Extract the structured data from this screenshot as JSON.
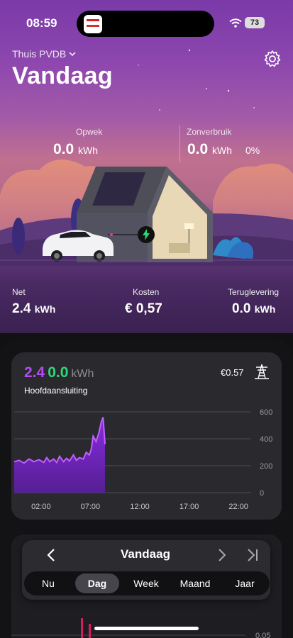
{
  "status": {
    "time": "08:59",
    "battery": "73"
  },
  "header": {
    "location": "Thuis PVDB",
    "title": "Vandaag"
  },
  "top_metrics": {
    "opwek": {
      "label": "Opwek",
      "value": "0.0",
      "unit": "kWh"
    },
    "zonverbruik": {
      "label": "Zonverbruik",
      "value": "0.0",
      "unit": "kWh",
      "percent": "0%"
    }
  },
  "bottom_metrics": {
    "net": {
      "label": "Net",
      "value": "2.4",
      "unit": "kWh"
    },
    "kosten": {
      "label": "Kosten",
      "value": "€ 0,57"
    },
    "teruglevering": {
      "label": "Teruglevering",
      "value": "0.0",
      "unit": "kWh"
    }
  },
  "card": {
    "value_a": "2.4",
    "value_b": "0.0",
    "unit": "kWh",
    "subtitle": "Hoofdaansluiting",
    "cost": "€0.57"
  },
  "chart_data": {
    "type": "area",
    "x_ticks": [
      "02:00",
      "07:00",
      "12:00",
      "17:00",
      "22:00"
    ],
    "y_ticks": [
      "600",
      "400",
      "200",
      "0"
    ],
    "ylim": [
      0,
      600
    ],
    "x_hours": [
      0,
      0.5,
      1,
      1.5,
      2,
      2.5,
      3,
      3.3,
      3.6,
      4,
      4.3,
      4.6,
      5,
      5.3,
      5.6,
      6,
      6.3,
      6.6,
      7,
      7.3,
      7.6,
      7.8,
      8,
      8.3,
      8.6,
      8.8,
      9,
      9.2
    ],
    "values": [
      230,
      240,
      220,
      250,
      230,
      245,
      225,
      260,
      230,
      250,
      225,
      270,
      230,
      255,
      235,
      280,
      240,
      260,
      250,
      300,
      280,
      320,
      420,
      380,
      450,
      520,
      560,
      360
    ],
    "series_color": "#8a2be2",
    "grid": true
  },
  "nav": {
    "title": "Vandaag",
    "segments": [
      "Nu",
      "Dag",
      "Week",
      "Maand",
      "Jaar"
    ],
    "active": "Dag"
  },
  "second_chart": {
    "y_tick": "0.05"
  }
}
